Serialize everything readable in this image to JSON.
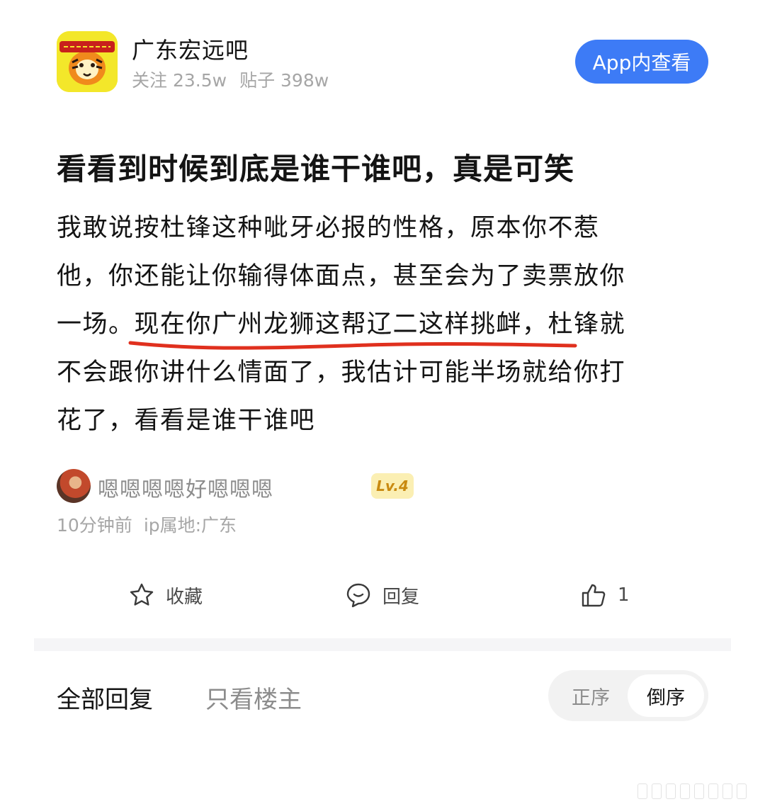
{
  "forum": {
    "logo_icon": "guangdong-tigers-logo",
    "name": "广东宏远吧",
    "followers": "关注 23.5w",
    "posts": "贴子 398w"
  },
  "header": {
    "app_button_label": "App内查看"
  },
  "post": {
    "title": "看看到时候到底是谁干谁吧，真是可笑",
    "body_lines": [
      "我敢说按杜锋这种呲牙必报的性格，原本你不惹",
      "他，你还能让你输得体面点，甚至会为了卖票放你",
      "一场。现在你广州龙狮这帮辽二这样挑衅，杜锋就",
      "不会跟你讲什么情面了，我估计可能半场就给你打",
      "花了，看看是谁干谁吧"
    ],
    "highlight_color": "#e0301e"
  },
  "author": {
    "name": "嗯嗯嗯嗯好嗯嗯嗯",
    "level": "Lv.4",
    "time": "10分钟前",
    "ip": "ip属地:广东"
  },
  "actions": {
    "favorite_label": "收藏",
    "reply_label": "回复",
    "like_count": "1"
  },
  "replies": {
    "tab_all": "全部回复",
    "tab_owner_only": "只看楼主",
    "sort_asc": "正序",
    "sort_desc": "倒序",
    "active_sort": "倒序"
  },
  "colors": {
    "accent": "#3d7bf6",
    "text": "#141414",
    "muted": "#a6a6a6"
  }
}
